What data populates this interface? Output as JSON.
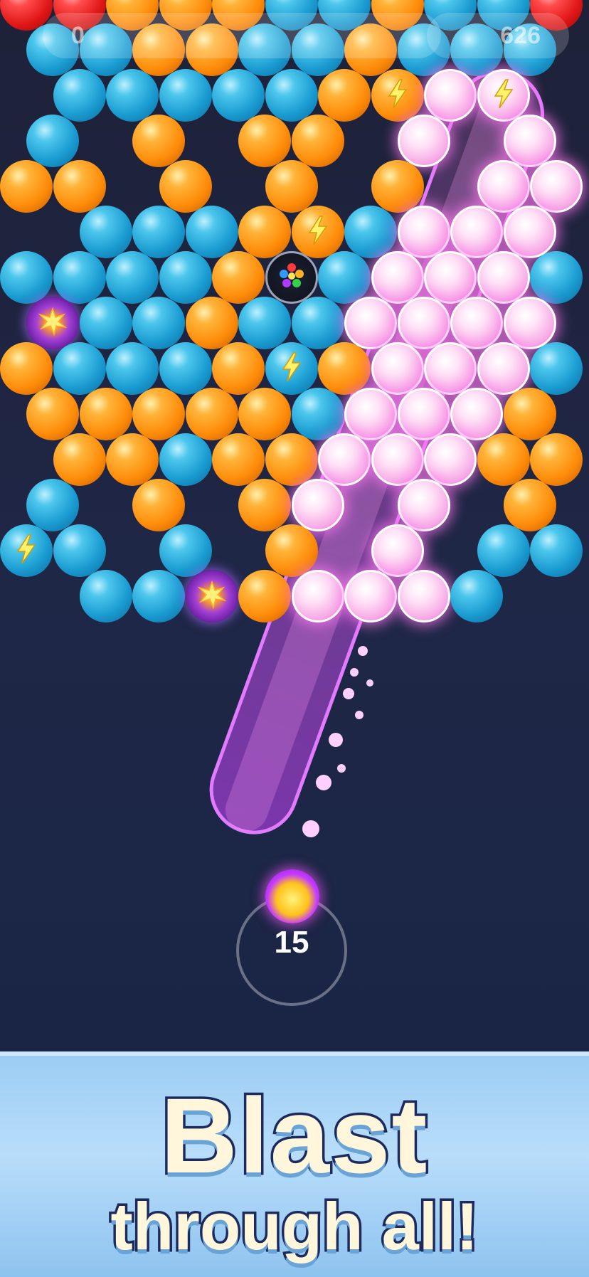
{
  "hud": {
    "left_value": "0",
    "right_value": "626"
  },
  "shooter": {
    "remaining_shots": "15",
    "current_bubble": "bomb"
  },
  "banner": {
    "line1": "Blast",
    "line2": "through all!"
  },
  "colors": {
    "blue": "#1a9bd1",
    "orange": "#ff8c0a",
    "red": "#e01717",
    "pink": "#f7a9e6",
    "beam": "#d64bff",
    "background": "#1e2138",
    "banner": "#9ccdf4"
  },
  "bubble_rows": [
    [
      "red",
      "red",
      "orange",
      "orange",
      "orange",
      "blue",
      "blue",
      "orange",
      "blue",
      "blue",
      "red"
    ],
    [
      "blue",
      "blue",
      "orange",
      "orange",
      "blue",
      "blue",
      "orange",
      "blue",
      "blue",
      "blue"
    ],
    [
      "",
      "blue",
      "blue",
      "blue",
      "blue",
      "blue",
      "orange",
      "orange-bolt",
      "pink",
      "pink-bolt",
      ""
    ],
    [
      "blue",
      "",
      "orange",
      "",
      "orange",
      "orange",
      "",
      "pink",
      "",
      "pink",
      ""
    ],
    [
      "orange",
      "orange",
      "",
      "orange",
      "",
      "orange",
      "",
      "orange",
      "",
      "pink",
      "pink"
    ],
    [
      "",
      "blue",
      "blue",
      "blue",
      "orange",
      "orange-bolt",
      "blue",
      "pink",
      "pink",
      "pink",
      ""
    ],
    [
      "blue",
      "blue",
      "blue",
      "blue",
      "orange",
      "rainbow",
      "blue",
      "pink",
      "pink",
      "pink",
      "blue"
    ],
    [
      "bomb",
      "blue",
      "blue",
      "orange",
      "blue",
      "blue",
      "pink",
      "pink",
      "pink",
      "pink",
      ""
    ],
    [
      "orange",
      "blue",
      "blue",
      "blue",
      "orange",
      "blue-bolt",
      "orange",
      "pink",
      "pink",
      "pink",
      "blue"
    ],
    [
      "orange",
      "orange",
      "orange",
      "orange",
      "orange",
      "blue",
      "pink",
      "pink",
      "pink",
      "orange",
      ""
    ],
    [
      "",
      "orange",
      "orange",
      "blue",
      "orange",
      "orange",
      "pink",
      "pink",
      "pink",
      "orange",
      "orange"
    ],
    [
      "blue",
      "",
      "orange",
      "",
      "orange",
      "pink",
      "",
      "pink",
      "",
      "orange",
      ""
    ],
    [
      "blue-bolt",
      "blue",
      "",
      "blue",
      "",
      "orange",
      "",
      "pink",
      "",
      "blue",
      "blue"
    ],
    [
      "",
      "blue",
      "blue",
      "bomb",
      "orange",
      "pink",
      "pink",
      "pink",
      "blue",
      "",
      ""
    ]
  ]
}
